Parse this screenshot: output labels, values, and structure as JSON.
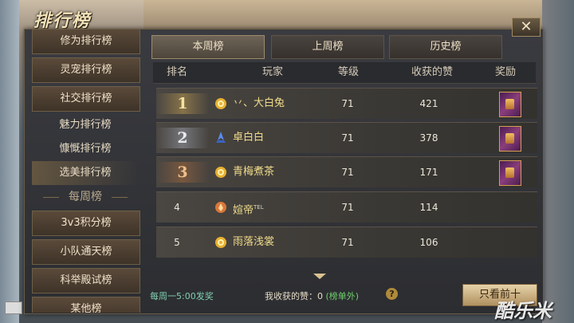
{
  "title": "排行榜",
  "close_glyph": "✕",
  "sidebar": {
    "items": [
      {
        "label": "修为排行榜",
        "style": "button"
      },
      {
        "label": "灵宠排行榜",
        "style": "button"
      },
      {
        "label": "社交排行榜",
        "style": "button"
      },
      {
        "label": "魅力排行榜",
        "style": "plain"
      },
      {
        "label": "慷慨排行榜",
        "style": "plain"
      },
      {
        "label": "选美排行榜",
        "style": "selected"
      }
    ],
    "weekly_header": "每周榜",
    "weekly_items": [
      "3v3积分榜",
      "小队通天榜",
      "科举殿试榜",
      "某他榜"
    ]
  },
  "tabs": [
    {
      "label": "本周榜",
      "active": true
    },
    {
      "label": "上周榜",
      "active": false
    },
    {
      "label": "历史榜",
      "active": false
    }
  ],
  "table": {
    "headers": [
      "排名",
      "玩家",
      "等级",
      "收获的赞",
      "奖励"
    ],
    "rows": [
      {
        "rank": "1",
        "player": "丷、大白兔",
        "tag": "",
        "icon": "sun-class-icon",
        "level": "71",
        "likes": "421",
        "reward": true
      },
      {
        "rank": "2",
        "player": "卓白白",
        "tag": "",
        "icon": "blade-class-icon",
        "level": "71",
        "likes": "378",
        "reward": true
      },
      {
        "rank": "3",
        "player": "青梅煮茶",
        "tag": "",
        "icon": "sun-class-icon",
        "level": "71",
        "likes": "171",
        "reward": true
      },
      {
        "rank": "4",
        "player": "媗帝",
        "tag": "TEL",
        "icon": "flame-class-icon",
        "level": "71",
        "likes": "114",
        "reward": false
      },
      {
        "rank": "5",
        "player": "雨落浅裳",
        "tag": "",
        "icon": "sun-class-icon",
        "level": "71",
        "likes": "106",
        "reward": false
      }
    ]
  },
  "footer": {
    "refresh_note": "每周一5:00发奖",
    "my_likes_label": "我收获的赞：0",
    "my_likes_status": "(榜单外)",
    "help_glyph": "?",
    "only_top_button": "只看前十"
  },
  "watermark": "酷乐米",
  "colors": {
    "accent_gold": "#f0dc8a",
    "footer_teal": "#7fd0b0",
    "status_green": "#6ed06a",
    "panel_bg": "#2c2d31"
  }
}
